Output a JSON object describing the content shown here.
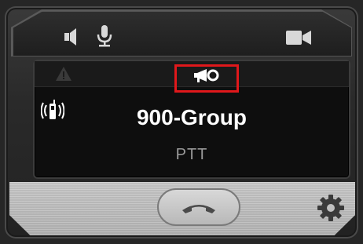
{
  "screen": {
    "group_name": "900-Group",
    "mode": "PTT"
  },
  "icons": {
    "top_left_1": "speaker-icon",
    "top_left_2": "microphone-icon",
    "top_right": "video-camera-icon",
    "status_left": "warning-icon",
    "status_center": "megaphone-icon",
    "screen_left": "radio-signal-icon",
    "bottom_center": "hangup-icon",
    "bottom_right": "gear-icon"
  },
  "colors": {
    "highlight": "#e0181b",
    "group_text": "#ffffff",
    "mode_text": "#9a9a9a"
  }
}
